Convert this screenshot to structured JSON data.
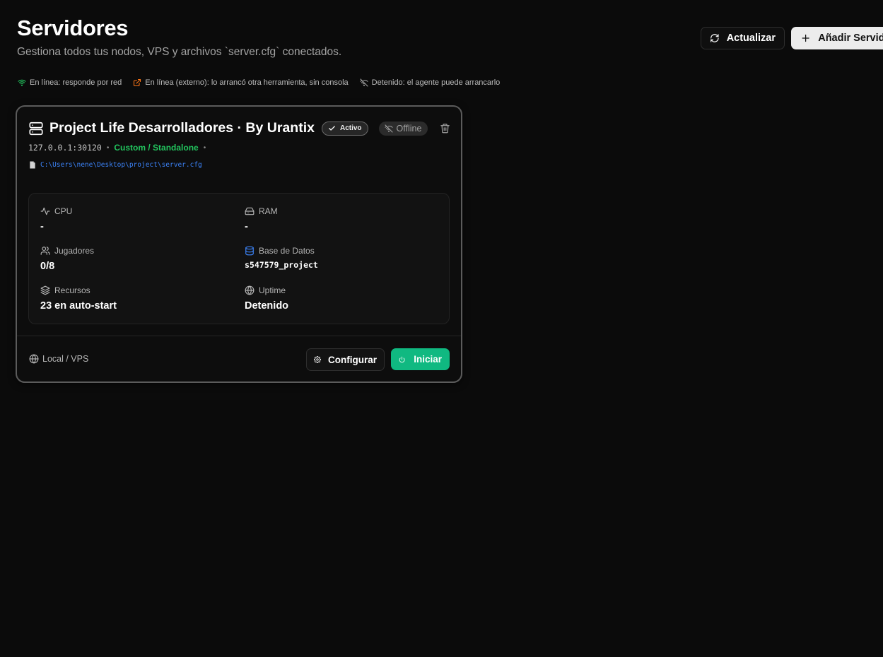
{
  "header": {
    "title": "Servidores",
    "subtitle": "Gestiona todos tus nodos, VPS y archivos `server.cfg` conectados.",
    "refresh_label": "Actualizar",
    "add_label": "Añadir Servidor"
  },
  "legend": {
    "online": "En línea: responde por red",
    "external": "En línea (externo): lo arrancó otra herramienta, sin consola",
    "stopped": "Detenido: el agente puede arrancarlo"
  },
  "colors": {
    "online": "#22c55e",
    "external": "#f97316",
    "path": "#3b82f6",
    "start_button": "#10b981"
  },
  "server": {
    "name": "Project Life Desarrolladores · By Urantix",
    "badge_active": "Activo",
    "badge_status": "Offline",
    "address": "127.0.0.1:30120",
    "separator": "•",
    "type": "Custom / Standalone",
    "config_path": "C:\\Users\\nene\\Desktop\\project\\server.cfg",
    "stats": {
      "cpu_label": "CPU",
      "cpu_value": "-",
      "ram_label": "RAM",
      "ram_value": "-",
      "players_label": "Jugadores",
      "players_value": "0/8",
      "db_label": "Base de Datos",
      "db_value": "s547579_project",
      "resources_label": "Recursos",
      "resources_value": "23 en auto-start",
      "uptime_label": "Uptime",
      "uptime_value": "Detenido"
    },
    "location": "Local / VPS",
    "configure_label": "Configurar",
    "start_label": "Iniciar"
  }
}
